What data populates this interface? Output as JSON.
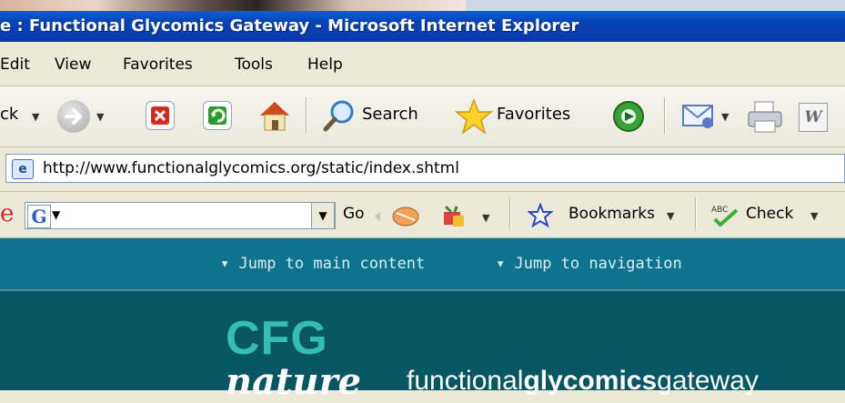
{
  "window": {
    "title": "e : Functional Glycomics Gateway - Microsoft Internet Explorer"
  },
  "menu": {
    "items": [
      "Edit",
      "View",
      "Favorites",
      "Tools",
      "Help"
    ]
  },
  "toolbar": {
    "back_label": "ck",
    "search_label": "Search",
    "favorites_label": "Favorites"
  },
  "address": {
    "url": "http://www.functionalglycomics.org/static/index.shtml"
  },
  "google_toolbar": {
    "logo_text": "G",
    "go_label": "Go",
    "bookmarks_label": "Bookmarks",
    "check_label": "Check"
  },
  "page": {
    "jump_main": "Jump to main content",
    "jump_nav": "Jump to navigation",
    "logo_cfg": "CFG",
    "logo_nature": "nature",
    "tagline_pre": "functional",
    "tagline_bold": "glycomics",
    "tagline_post": "gateway"
  },
  "colors": {
    "titlebar": "#0842b8",
    "page_nav": "#0f7390",
    "page_head": "#085563",
    "cfg_teal": "#33bdb6"
  }
}
